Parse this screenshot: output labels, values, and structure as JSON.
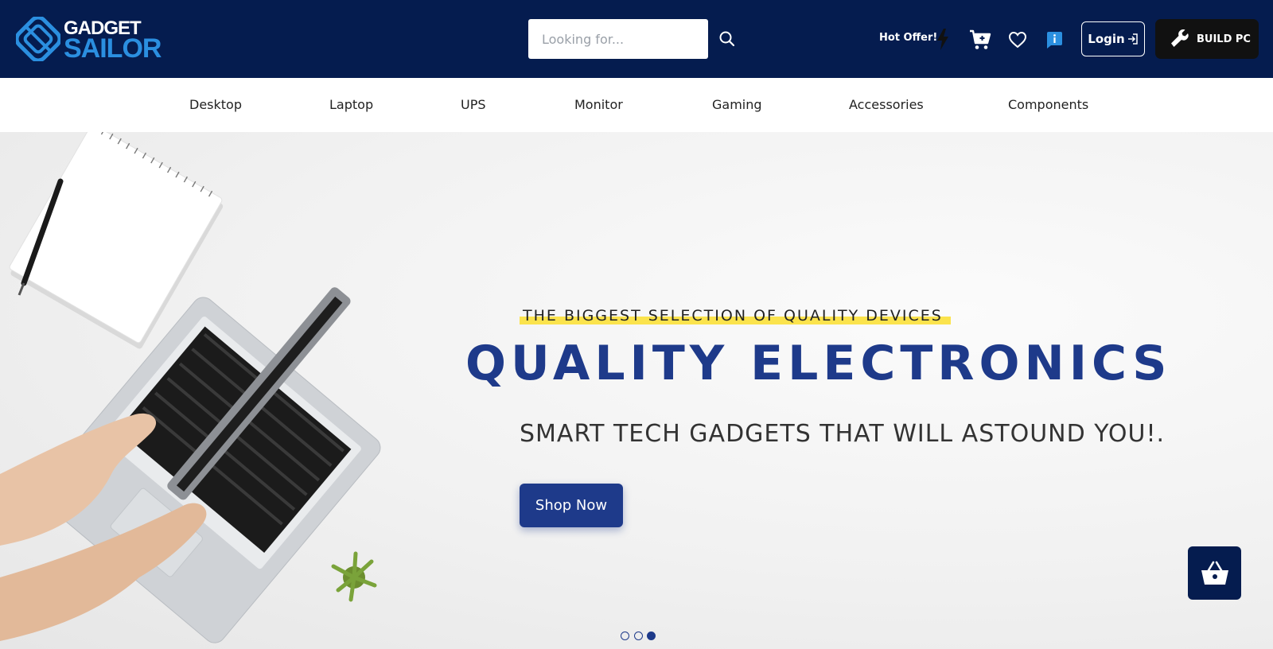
{
  "brand": {
    "name_top": "GADGET",
    "name_bottom": "SAILOR",
    "primary_color": "#051c4f",
    "accent_color": "#2b8fe0"
  },
  "header": {
    "search": {
      "placeholder": "Looking for...",
      "value": "",
      "icon": "search-icon"
    },
    "hot_offer": {
      "label": "Hot Offer!",
      "icon": "bolt-icon"
    },
    "icons": [
      "cart-icon",
      "heart-icon",
      "info-icon"
    ],
    "login": {
      "label": "Login",
      "icon": "login-arrow-icon"
    },
    "build_pc": {
      "label": "BUILD PC",
      "icon": "wrench-icon"
    }
  },
  "nav": {
    "items": [
      {
        "label": "Desktop"
      },
      {
        "label": "Laptop"
      },
      {
        "label": "UPS"
      },
      {
        "label": "Monitor"
      },
      {
        "label": "Gaming"
      },
      {
        "label": "Accessories"
      },
      {
        "label": "Components"
      }
    ]
  },
  "hero": {
    "tagline": "THE BIGGEST SELECTION OF QUALITY DEVICES",
    "headline": "QUALITY ELECTRONICS",
    "subline": "SMART TECH GADGETS THAT WILL ASTOUND YOU!.",
    "cta": "Shop Now",
    "highlight_color": "#fbe34d",
    "headline_color": "#1e3a8a",
    "carousel": {
      "total_slides": 3,
      "active_slide": 3
    }
  },
  "floating": {
    "basket_icon": "basket-icon"
  }
}
